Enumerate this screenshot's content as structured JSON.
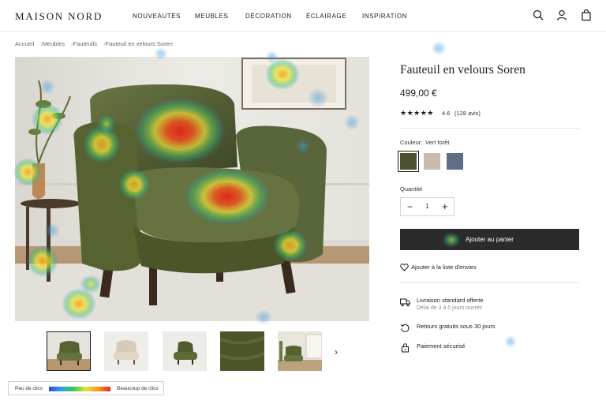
{
  "brand": "MAISON NORD",
  "nav": [
    "NOUVEAUTÉS",
    "MEUBLES",
    "DÉCORATION",
    "ÉCLAIRAGE",
    "INSPIRATION"
  ],
  "header_icons": [
    "search-icon",
    "account-icon",
    "shopping-bag-icon"
  ],
  "breadcrumb": [
    "Accueil",
    "Meubles",
    "Fauteuils",
    "Fauteuil en velours Soren"
  ],
  "product": {
    "title": "Fauteuil en velours Soren",
    "price": "499,00 €",
    "stars": "★★★★★",
    "rating": "4.6",
    "reviews": "(128 avis)",
    "color_label": "Couleur:",
    "color_value": "Vert forêt",
    "swatches": [
      {
        "name": "Vert forêt",
        "color": "#4a5230",
        "selected": true
      },
      {
        "name": "beige",
        "color": "#c8bcab",
        "selected": false
      },
      {
        "name": "bleu",
        "color": "#5d6f86",
        "selected": false
      }
    ],
    "quantity_label": "Quantité",
    "quantity": "1",
    "minus": "−",
    "plus": "+",
    "add_to_cart": "Ajouter au panier",
    "wishlist": "Ajouter à la liste d'envies"
  },
  "services": [
    {
      "icon": "truck-icon",
      "title": "Livraison standard offerte",
      "subtitle": "Délai de 3 à 5 jours ouvrés"
    },
    {
      "icon": "return-icon",
      "title": "Retours gratuits sous 30 jours",
      "subtitle": ""
    },
    {
      "icon": "lock-icon",
      "title": "Paiement sécurisé",
      "subtitle": ""
    }
  ],
  "gallery": {
    "thumbnails": [
      "green-armchair",
      "beige-armchair",
      "green-armchair-side",
      "velvet-swatch",
      "living-room"
    ],
    "next": "›"
  },
  "heatmap_legend": {
    "low": "Peu de clics",
    "high": "Beaucoup de clics"
  },
  "colors": {
    "accent_dark": "#2b2b2b",
    "velvet_green": "#4f5a32"
  }
}
